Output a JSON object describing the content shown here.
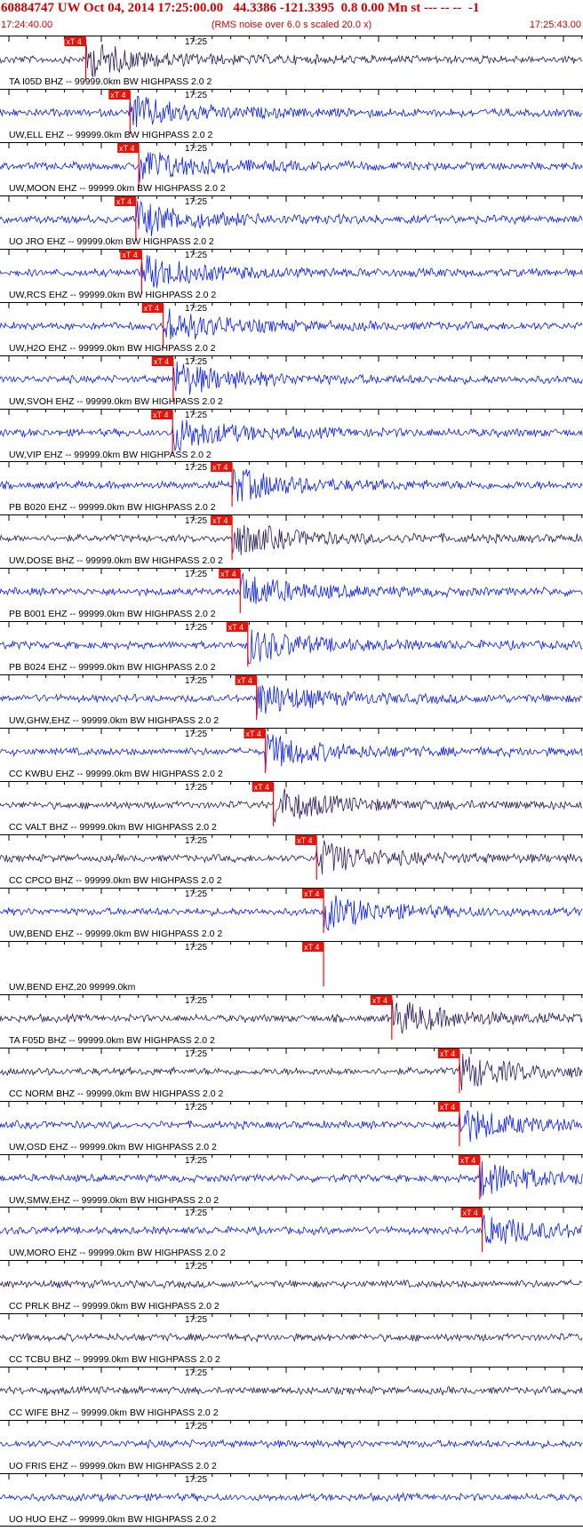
{
  "header": {
    "title": "60884747 UW Oct 04, 2014 17:25:00.00   44.3386 -121.3395  0.8 0.00 Mn st --- -- --  -1",
    "start_time": "17:24:40.00",
    "note": "(RMS noise over 6.0 s scaled 20.0 x)",
    "end_time": "17:25:43.00"
  },
  "time_label": "17:25",
  "pick_label": "xT 4",
  "colors": {
    "header_text": "#d40000",
    "blue_trace": "#0a1ee6",
    "dark_trace": "#2a1a5e",
    "pick": "#ff0000",
    "pick_box": "#e8140a",
    "grid": "#000000"
  },
  "traces": [
    {
      "label": "TA I05D BHZ -- 99999.0km BW  HIGHPASS  2.0  2",
      "color": "dark",
      "pick": 0.147
    },
    {
      "label": "UW,ELL EHZ -- 99999.0km BW  HIGHPASS  2.0  2",
      "color": "blue",
      "pick": 0.223
    },
    {
      "label": "UW,MOON EHZ -- 99999.0km BW  HIGHPASS  2.0  2",
      "color": "blue",
      "pick": 0.238
    },
    {
      "label": "UO JRO EHZ -- 99999.0km BW  HIGHPASS  2.0  2",
      "color": "blue",
      "pick": 0.233
    },
    {
      "label": "UW,RCS EHZ -- 99999.0km BW  HIGHPASS  2.0  2",
      "color": "blue",
      "pick": 0.243
    },
    {
      "label": "UW,H2O EHZ -- 99999.0km BW  HIGHPASS  2.0  2",
      "color": "blue",
      "pick": 0.28
    },
    {
      "label": "UW,SVOH EHZ -- 99999.0km BW  HIGHPASS  2.0  2",
      "color": "blue",
      "pick": 0.297
    },
    {
      "label": "UW,VIP EHZ -- 99999.0km BW  HIGHPASS  2.0  2",
      "color": "blue",
      "pick": 0.296
    },
    {
      "label": "PB B020 EHZ -- 99999.0km BW  HIGHPASS  2.0  2",
      "color": "blue",
      "pick": 0.398
    },
    {
      "label": "UW,DOSE BHZ -- 99999.0km BW  HIGHPASS  2.0  2",
      "color": "dark",
      "pick": 0.398
    },
    {
      "label": "PB B001 EHZ -- 99999.0km BW  HIGHPASS  2.0  2",
      "color": "blue",
      "pick": 0.412
    },
    {
      "label": "PB B024 EHZ -- 99999.0km BW  HIGHPASS  2.0  2",
      "color": "blue",
      "pick": 0.425
    },
    {
      "label": "UW,GHW,EHZ -- 99999.0km BW  HIGHPASS  2.0  2",
      "color": "blue",
      "pick": 0.44
    },
    {
      "label": "CC KWBU EHZ -- 99999.0km BW  HIGHPASS  2.0  2",
      "color": "blue",
      "pick": 0.455
    },
    {
      "label": "CC VALT BHZ -- 99999.0km BW  HIGHPASS  2.0  2",
      "color": "dark",
      "pick": 0.469
    },
    {
      "label": "CC CPCO BHZ -- 99999.0km BW  HIGHPASS  2.0  2",
      "color": "dark",
      "pick": 0.543
    },
    {
      "label": "UW,BEND EHZ -- 99999.0km BW  HIGHPASS  2.0  2",
      "color": "blue",
      "pick": 0.555
    },
    {
      "label": "UW,BEND EHZ,20 99999.0km",
      "color": "none",
      "pick": 0.555
    },
    {
      "label": "TA F05D BHZ -- 99999.0km BW  HIGHPASS  2.0  2",
      "color": "dark",
      "pick": 0.672
    },
    {
      "label": "CC NORM BHZ -- 99999.0km BW  HIGHPASS  2.0  2",
      "color": "dark",
      "pick": 0.788
    },
    {
      "label": "UW,OSD EHZ -- 99999.0km BW  HIGHPASS  2.0  2",
      "color": "blue",
      "pick": 0.788
    },
    {
      "label": "UW,SMW,EHZ -- 99999.0km BW  HIGHPASS  2.0  2",
      "color": "blue",
      "pick": 0.823
    },
    {
      "label": "UW,MORO EHZ -- 99999.0km BW  HIGHPASS  2.0  2",
      "color": "blue",
      "pick": 0.827
    },
    {
      "label": "CC PRLK BHZ -- 99999.0km BW  HIGHPASS  2.0  2",
      "color": "dark",
      "pick": null
    },
    {
      "label": "CC TCBU BHZ -- 99999.0km BW  HIGHPASS  2.0  2",
      "color": "dark",
      "pick": null
    },
    {
      "label": "CC WIFE BHZ -- 99999.0km BW  HIGHPASS  2.0  2",
      "color": "dark",
      "pick": null
    },
    {
      "label": "UO FRIS EHZ -- 99999.0km BW  HIGHPASS  2.0  2",
      "color": "blue",
      "pick": null
    },
    {
      "label": "UO HUO EHZ -- 99999.0km BW  HIGHPASS  2.0  2",
      "color": "blue",
      "pick": null
    }
  ]
}
